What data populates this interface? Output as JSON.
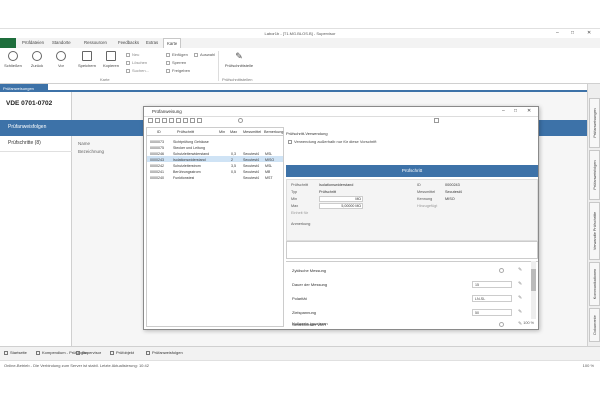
{
  "window": {
    "title": "Labor1b - [T1.MG.BLOS.B] - Supervisor",
    "min_glyph": "–",
    "max_glyph": "□",
    "close_glyph": "✕"
  },
  "menu": {
    "items": [
      "Prüfdateien",
      "Standorte",
      "Ressourcen",
      "Feedbacks",
      "Extras",
      "Karte"
    ],
    "active_index": 5
  },
  "ribbon": {
    "buttons": [
      {
        "label": "Schließen"
      },
      {
        "label": "Zurück"
      },
      {
        "label": "Vor"
      },
      {
        "label": "Speichern"
      },
      {
        "label": "Kopieren"
      }
    ],
    "options_col1": [
      "Neu",
      "Löschen",
      "Suchen..."
    ],
    "options_col2": [
      "Einfügen",
      "Auswahl",
      "Sperren",
      "Freigeben"
    ],
    "group_label": "Karte",
    "pruef_button": "Prüfschnittstelle",
    "pruef_group": "Prüfschnittstellen"
  },
  "doc_tab": "Prüfanweisungen",
  "sidebar": {
    "title": "VDE 0701-0702",
    "active_item": "Prüfanweisfolgen",
    "item": "Prüfschritte (8)"
  },
  "main": {
    "field1": "Name",
    "field2": "Bezeichnung"
  },
  "right_tabs": [
    "Prüfanweisungen",
    "Prüfanweisfolgen",
    "Verwandte Prüfschritte",
    "Kommunikationen",
    "Dokumente"
  ],
  "bottom_tabs": [
    "Startseite",
    "Kompendium - Prüfungen",
    "Supervisor",
    "Prüfobjekt",
    "Prüfanweisfolgen"
  ],
  "status": {
    "text": "Online-Betrieb - Die Verbindung zum Server ist stabil. Letzte Aktualisierung: 10:42",
    "zoom": "100 %"
  },
  "dialog": {
    "title": "Prüfanweisung",
    "columns": [
      "ID",
      "Prüfschritt",
      "Min",
      "Max",
      "Messmittel",
      "Bemerkung"
    ],
    "rows": [
      {
        "id": "0000073",
        "name": "Sichtprüfung Gehäuse",
        "min": "",
        "max": "",
        "mm": "",
        "note": ""
      },
      {
        "id": "0000075",
        "name": "Stecker und Leitung",
        "min": "",
        "max": "",
        "mm": "",
        "note": ""
      },
      {
        "id": "0000246",
        "name": "Schutzleiterwiderstand",
        "min": "0,3",
        "max": "",
        "mm": "Secutest4",
        "note": "MSL"
      },
      {
        "id": "0000243",
        "name": "Isolationswiderstand",
        "min": "2",
        "max": "",
        "mm": "Secutest4",
        "note": "MISO"
      },
      {
        "id": "0000242",
        "name": "Schutzleiterstrom",
        "min": "3,5",
        "max": "",
        "mm": "Secutest4",
        "note": "MSL"
      },
      {
        "id": "0000241",
        "name": "Berührungsstrom",
        "min": "0,5",
        "max": "",
        "mm": "Secutest4",
        "note": "MB"
      },
      {
        "id": "0000240",
        "name": "Funktionstest",
        "min": "",
        "max": "",
        "mm": "Secutest4",
        "note": "MST"
      }
    ],
    "selected_row": 3,
    "right": {
      "heading": "Prüfschritt-Verwendung",
      "checkbox": "Verwendung außerhalb nur für diese Vorschrift",
      "band_title": "Prüfschritt",
      "props": {
        "pruefschritt_label": "Prüfschritt",
        "pruefschritt_value": "Isolationswiderstand",
        "typ_label": "Typ",
        "typ_value": "Prüfschritt",
        "min_label": "Min",
        "min_value": "MΩ",
        "max_label": "Max",
        "max_value": "5,00000 MΩ",
        "einheit_label": "Einheit für",
        "id_label": "ID",
        "id_value": "0000243",
        "messmittel_label": "Messmittel",
        "messmittel_value": "Secutest4",
        "kennung_label": "Kennung",
        "kennung_value": "MISO",
        "zusatz_label": "Hinzugefügt",
        "anmerkung_label": "Anmerkung"
      },
      "lower": [
        {
          "label": "Zyklische Messung",
          "type": "check"
        },
        {
          "label": "Dauer der Messung",
          "type": "input",
          "value": "15"
        },
        {
          "label": "Polarität",
          "type": "input",
          "value": "LN-SL"
        },
        {
          "label": "Zielspannung",
          "type": "input",
          "value": "50"
        },
        {
          "label": "Schlechtester Wert",
          "type": "check"
        },
        {
          "label": "Nullwerte ignorieren",
          "type": "check"
        }
      ],
      "zoom": "100 %"
    }
  }
}
